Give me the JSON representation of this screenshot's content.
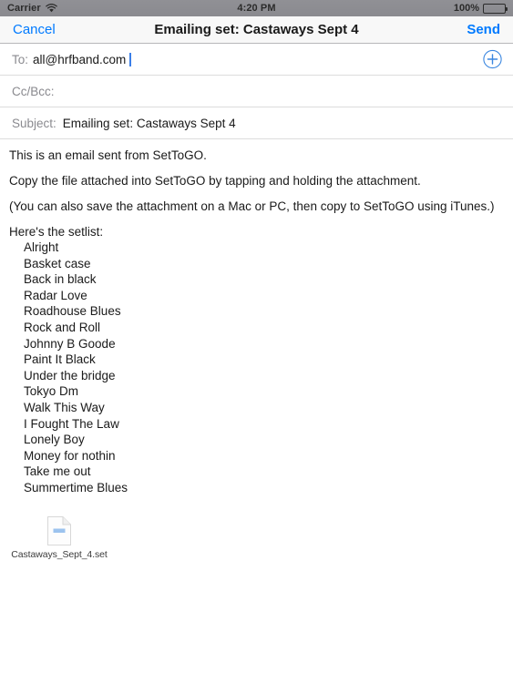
{
  "status_bar": {
    "carrier": "Carrier",
    "wifi_icon": "wifi-icon",
    "time": "4:20 PM",
    "battery_percent": "100%",
    "battery_icon": "battery-full-icon"
  },
  "nav_bar": {
    "cancel_label": "Cancel",
    "title": "Emailing set: Castaways Sept 4",
    "send_label": "Send",
    "accent_color": "#007aff"
  },
  "compose": {
    "to": {
      "label": "To:",
      "value": "all@hrfband.com",
      "placeholder": "",
      "add_icon": "add-contact-icon"
    },
    "cc_bcc": {
      "label": "Cc/Bcc:",
      "value": "",
      "placeholder": "Cc/Bcc:"
    },
    "subject": {
      "label": "Subject:",
      "value": "Emailing set: Castaways Sept 4",
      "placeholder": "Subject:"
    },
    "body": {
      "paragraphs": [
        "This is an email sent from SetToGO.",
        "Copy the file attached into SetToGO by tapping and holding the attachment.",
        "(You can also save the attachment on a Mac or PC, then copy to SetToGO using iTunes.)"
      ],
      "setlist_heading": "Here's the setlist:",
      "songs": [
        "Alright",
        "Basket case",
        "Back in black",
        "Radar Love",
        "Roadhouse Blues",
        "Rock and Roll",
        "Johnny B Goode",
        "Paint It Black",
        "Under the bridge",
        "Tokyo Dm",
        "Walk This Way",
        "I Fought The Law",
        "Lonely Boy",
        "Money for nothin",
        "Take me out",
        "Summertime Blues"
      ]
    },
    "attachment": {
      "filename": "Castaways_Sept_4.set",
      "icon": "document-file-icon",
      "icon_badge": "html"
    }
  }
}
